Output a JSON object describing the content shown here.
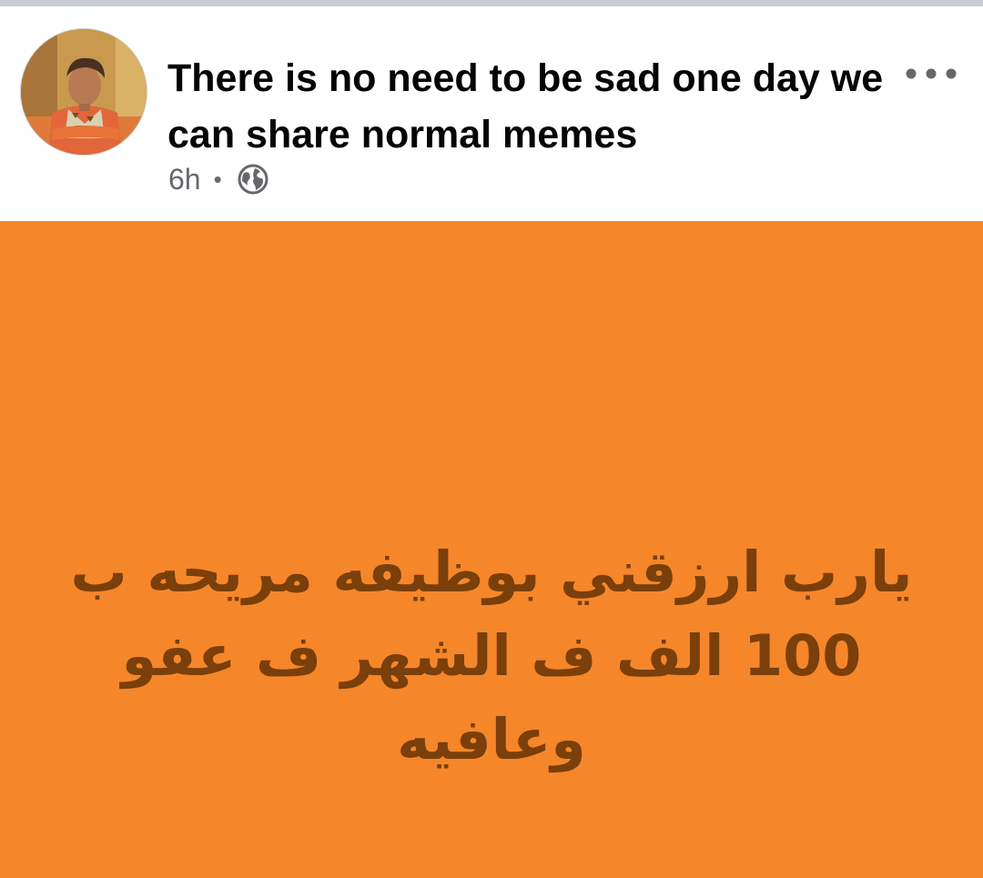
{
  "post": {
    "title": "There is no need to be sad one day we can share normal memes",
    "time": "6h",
    "separator": "•",
    "privacy_icon": "globe-icon",
    "more_icon": "more-options-icon"
  },
  "avatar": {
    "icon": "profile-avatar"
  },
  "meme": {
    "text": "يارب ارزقني بوظيفه مريحه ب 100 الف ف الشهر ف عفو وعافيه",
    "background_color": "#f5862a",
    "text_color": "#7a3f0a"
  },
  "colors": {
    "title": "#050505",
    "meta": "#65676b",
    "divider": "#c9ccd1"
  }
}
